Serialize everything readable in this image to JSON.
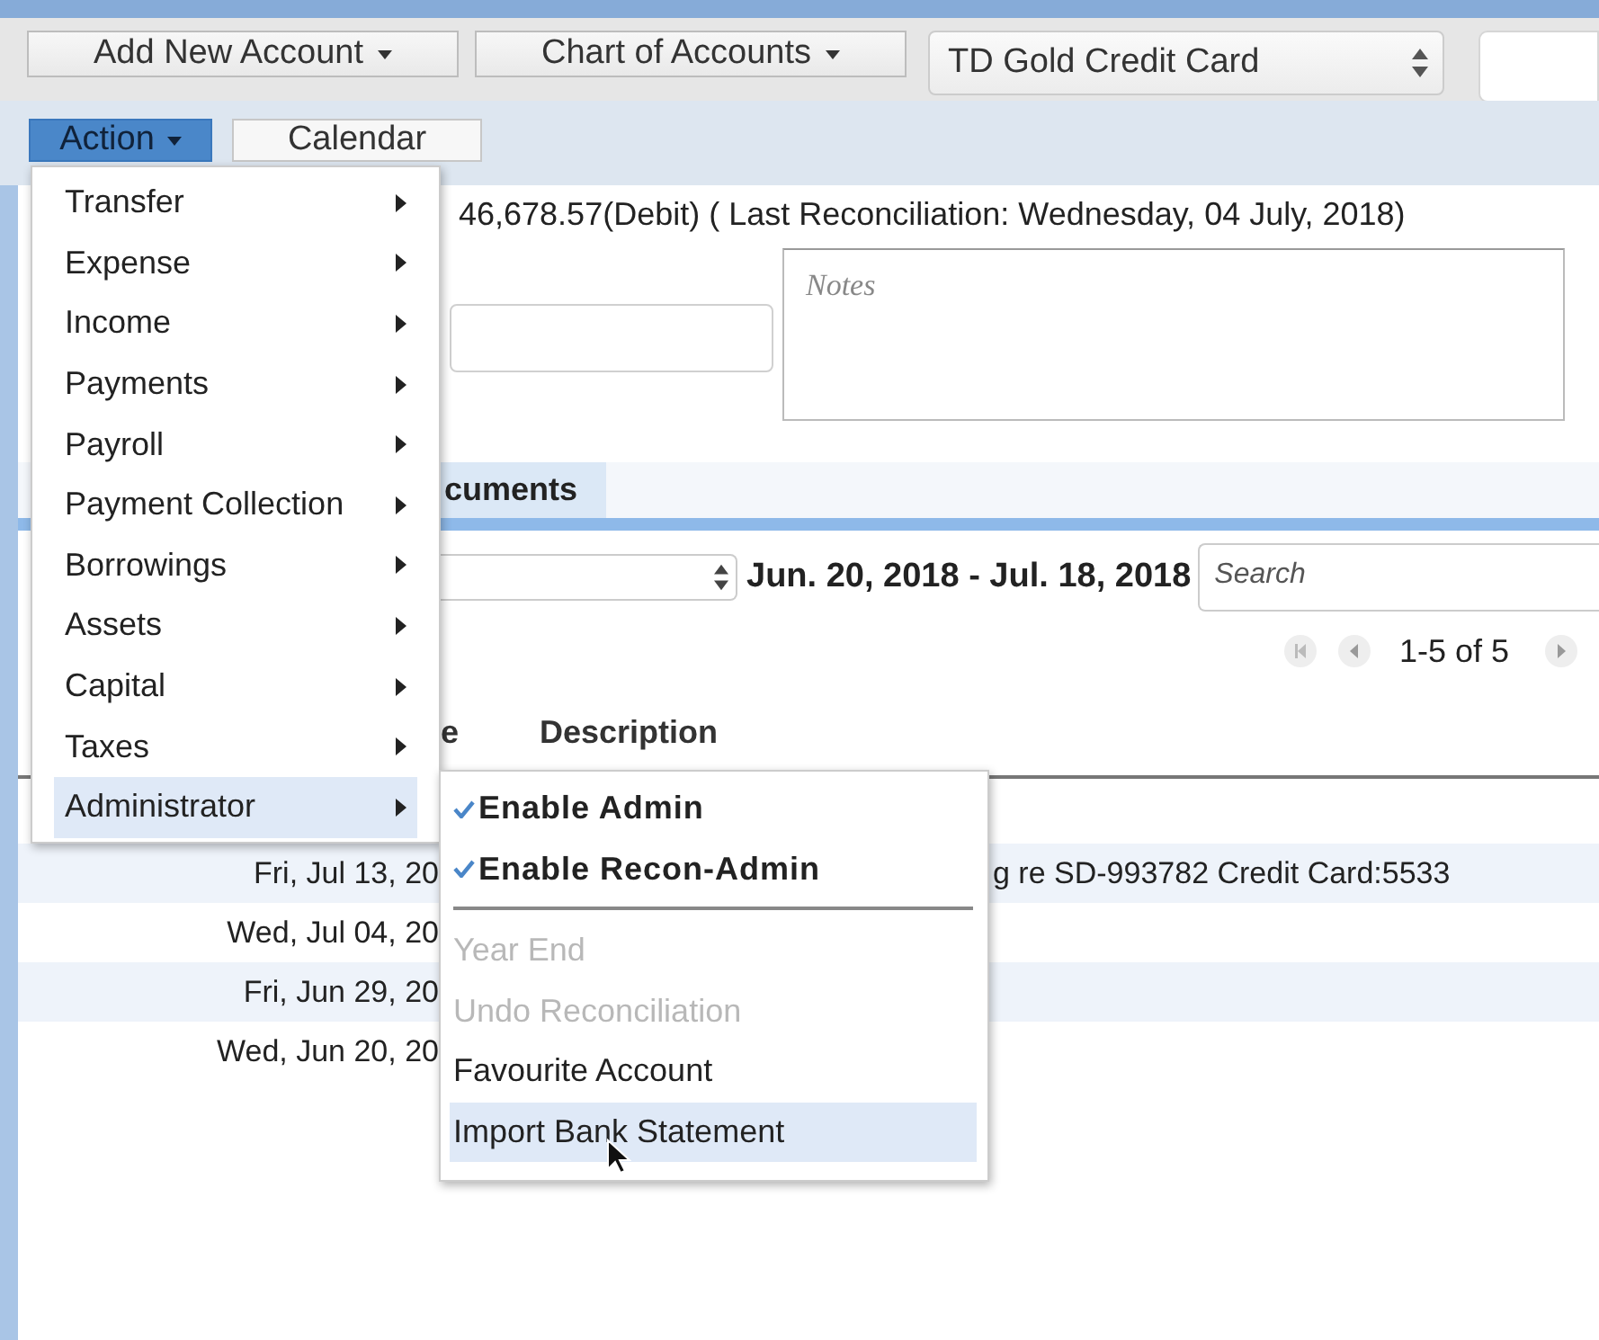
{
  "toolbar": {
    "buttons": [
      {
        "label": "Add New Account"
      },
      {
        "label": "Chart of Accounts"
      }
    ],
    "account_select": {
      "value": "TD Gold Credit Card"
    }
  },
  "action_bar": {
    "buttons": [
      {
        "label": "Action",
        "selected": true
      },
      {
        "label": "Calendar",
        "selected": false
      }
    ]
  },
  "account_info": {
    "balance": "46,678.57(Debit) ( Last Reconciliation: Wednesday, 04 July, 2018)",
    "notes": {
      "placeholder": "Notes"
    }
  },
  "tabs": [
    {
      "label": "cuments"
    }
  ],
  "filter": {
    "date_range": "Jun. 20, 2018 - Jul. 18, 2018",
    "search": {
      "placeholder": "Search"
    }
  },
  "pager": {
    "text": "1-5 of 5"
  },
  "table": {
    "columns": [
      "e",
      "Description"
    ],
    "rows": [
      {
        "date": "Fri, Jul 13, 20",
        "description": "g re SD-993782 Credit Card:5533"
      },
      {
        "date": "Wed, Jul 04, 20"
      },
      {
        "date": "Fri, Jun 29, 20"
      },
      {
        "date": "Wed, Jun 20, 20"
      }
    ]
  },
  "action_menu": {
    "items": [
      {
        "label": "Transfer",
        "selected": false
      },
      {
        "label": "Expense",
        "selected": false
      },
      {
        "label": "Income",
        "selected": false
      },
      {
        "label": "Payments",
        "selected": false
      },
      {
        "label": "Payroll",
        "selected": false
      },
      {
        "label": "Payment Collection",
        "selected": false
      },
      {
        "label": "Borrowings",
        "selected": false
      },
      {
        "label": "Assets",
        "selected": false
      },
      {
        "label": "Capital",
        "selected": false
      },
      {
        "label": "Taxes",
        "selected": false
      },
      {
        "label": "Administrator",
        "selected": true
      }
    ]
  },
  "submenu": {
    "items": [
      {
        "kind": "check",
        "label": "Enable Admin",
        "checked": true,
        "selected": false
      },
      {
        "kind": "check",
        "label": "Enable Recon-Admin",
        "checked": true,
        "selected": false
      },
      {
        "kind": "separator"
      },
      {
        "kind": "item",
        "label": "Year End",
        "disabled": true,
        "selected": false
      },
      {
        "kind": "item",
        "label": "Undo Reconciliation",
        "disabled": true,
        "selected": false
      },
      {
        "kind": "item",
        "label": "Favourite Account",
        "disabled": false,
        "selected": false
      },
      {
        "kind": "item",
        "label": "Import Bank Statement",
        "disabled": false,
        "selected": true
      }
    ]
  }
}
